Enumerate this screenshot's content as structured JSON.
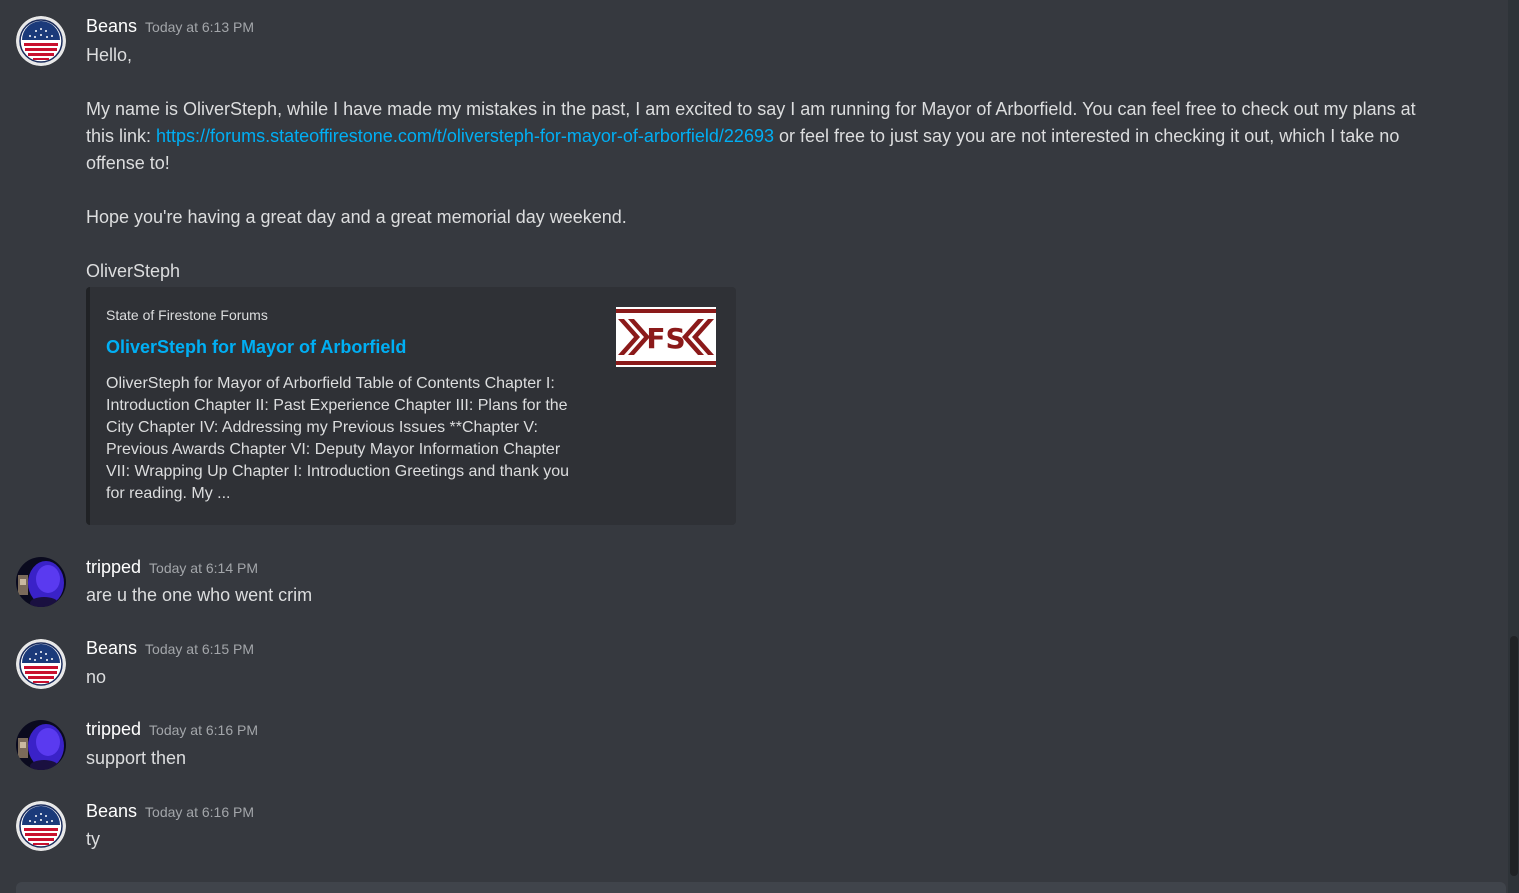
{
  "messages": [
    {
      "username": "Beans",
      "timestamp": "Today at 6:13 PM",
      "lines": {
        "greeting": "Hello,",
        "para1_a": "My name is OliverSteph, while I have made my mistakes in the past, I am excited to say I am running for Mayor of Arborfield. You can feel free to check out my plans at this link: ",
        "para1_link": "https://forums.stateoffirestone.com/t/oliversteph-for-mayor-of-arborfield/22693",
        "para1_b": " or feel free to just say you are not interested in checking it out, which I take no offense to!",
        "para2": "Hope you're having a great day and a great memorial day weekend.",
        "signoff": "OliverSteph"
      },
      "embed": {
        "provider": "State of Firestone Forums",
        "title": "OliverSteph for Mayor of Arborfield",
        "description": "OliverSteph for Mayor of Arborfield Table of Contents Chapter I: Introduction Chapter II: Past Experience Chapter III: Plans for the City Chapter IV: Addressing my Previous Issues **Chapter V: Previous Awards Chapter VI: Deputy Mayor Information Chapter VII: Wrapping Up Chapter I: Introduction Greetings and thank you for reading. My ...",
        "thumbnail_text": "FS"
      }
    },
    {
      "username": "tripped",
      "timestamp": "Today at 6:14 PM",
      "text": "are u the one who went crim"
    },
    {
      "username": "Beans",
      "timestamp": "Today at 6:15 PM",
      "text": "no"
    },
    {
      "username": "tripped",
      "timestamp": "Today at 6:16 PM",
      "text": "support then"
    },
    {
      "username": "Beans",
      "timestamp": "Today at 6:16 PM",
      "text": "ty"
    }
  ],
  "colors": {
    "background": "#36393f",
    "link": "#00aff4",
    "embed_bg": "#2f3136"
  }
}
